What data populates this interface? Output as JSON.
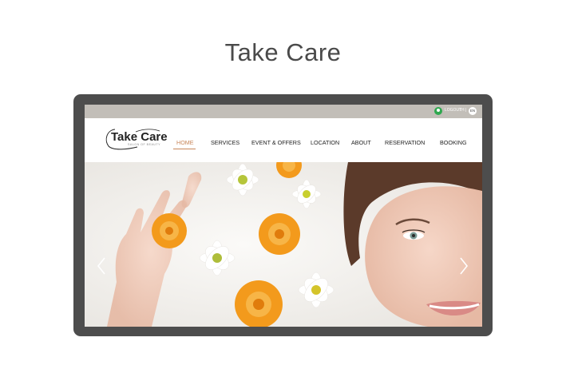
{
  "page": {
    "title": "Take Care"
  },
  "topbar": {
    "logout_label": "LOGOUT",
    "lang_th": "TH",
    "separator": "|",
    "lang_en": "EN",
    "icon": "user-icon",
    "icon_color": "#2fa84f"
  },
  "logo": {
    "name": "Take Care",
    "tagline": "SALON OF BEAUTY"
  },
  "nav": {
    "items": [
      {
        "label": "HOME",
        "active": true
      },
      {
        "label": "SERVICES"
      },
      {
        "label": "EVENT & OFFERS"
      },
      {
        "label": "LOCATION"
      },
      {
        "label": "ABOUT"
      },
      {
        "label": "RESERVATION"
      },
      {
        "label": "BOOKING"
      }
    ]
  },
  "hero": {
    "prev_icon": "chevron-left-icon",
    "next_icon": "chevron-right-icon"
  },
  "colors": {
    "accent": "#c8875a",
    "device_frame": "#4d4d4d",
    "topbar": "#c2beb8",
    "flower_orange": "#f39a1c"
  }
}
